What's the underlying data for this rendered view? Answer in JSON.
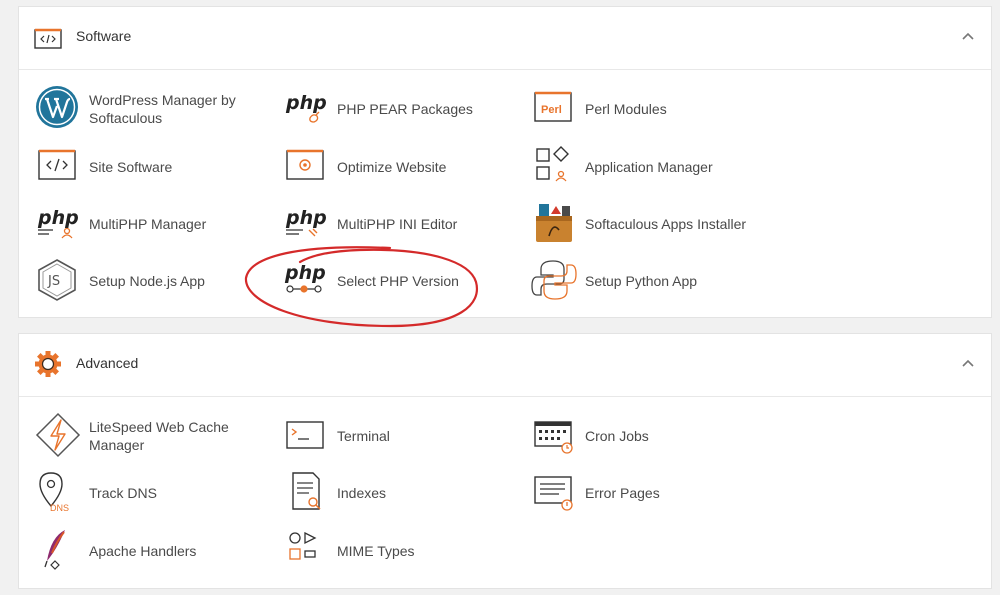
{
  "software": {
    "title": "Software",
    "items": [
      {
        "label": "WordPress Manager by Softaculous",
        "icon": "wordpress-icon"
      },
      {
        "label": "PHP PEAR Packages",
        "icon": "php-pear-icon"
      },
      {
        "label": "Perl Modules",
        "icon": "perl-icon",
        "icon_text": "Perl"
      },
      {
        "label": "Site Software",
        "icon": "code-window-icon"
      },
      {
        "label": "Optimize Website",
        "icon": "optimize-gear-icon"
      },
      {
        "label": "Application Manager",
        "icon": "app-grid-icon"
      },
      {
        "label": "MultiPHP Manager",
        "icon": "multiphp-icon"
      },
      {
        "label": "MultiPHP INI Editor",
        "icon": "php-ini-icon"
      },
      {
        "label": "Softaculous Apps Installer",
        "icon": "softaculous-icon"
      },
      {
        "label": "Setup Node.js App",
        "icon": "nodejs-icon",
        "icon_text": "JS"
      },
      {
        "label": "Select PHP Version",
        "icon": "php-version-icon"
      },
      {
        "label": "Setup Python App",
        "icon": "python-icon"
      }
    ]
  },
  "advanced": {
    "title": "Advanced",
    "items": [
      {
        "label": "LiteSpeed Web Cache Manager",
        "icon": "litespeed-icon"
      },
      {
        "label": "Terminal",
        "icon": "terminal-icon"
      },
      {
        "label": "Cron Jobs",
        "icon": "cron-calendar-icon"
      },
      {
        "label": "Track DNS",
        "icon": "dns-pin-icon",
        "icon_text": "DNS"
      },
      {
        "label": "Indexes",
        "icon": "indexes-doc-icon"
      },
      {
        "label": "Error Pages",
        "icon": "error-page-icon"
      },
      {
        "label": "Apache Handlers",
        "icon": "apache-feather-icon"
      },
      {
        "label": "MIME Types",
        "icon": "mime-shapes-icon"
      }
    ]
  },
  "php_word": "php",
  "colors": {
    "accent_orange": "#e8742c",
    "annotation_red": "#d42a2a",
    "wordpress_blue": "#21759b",
    "icon_dark": "#333333"
  }
}
